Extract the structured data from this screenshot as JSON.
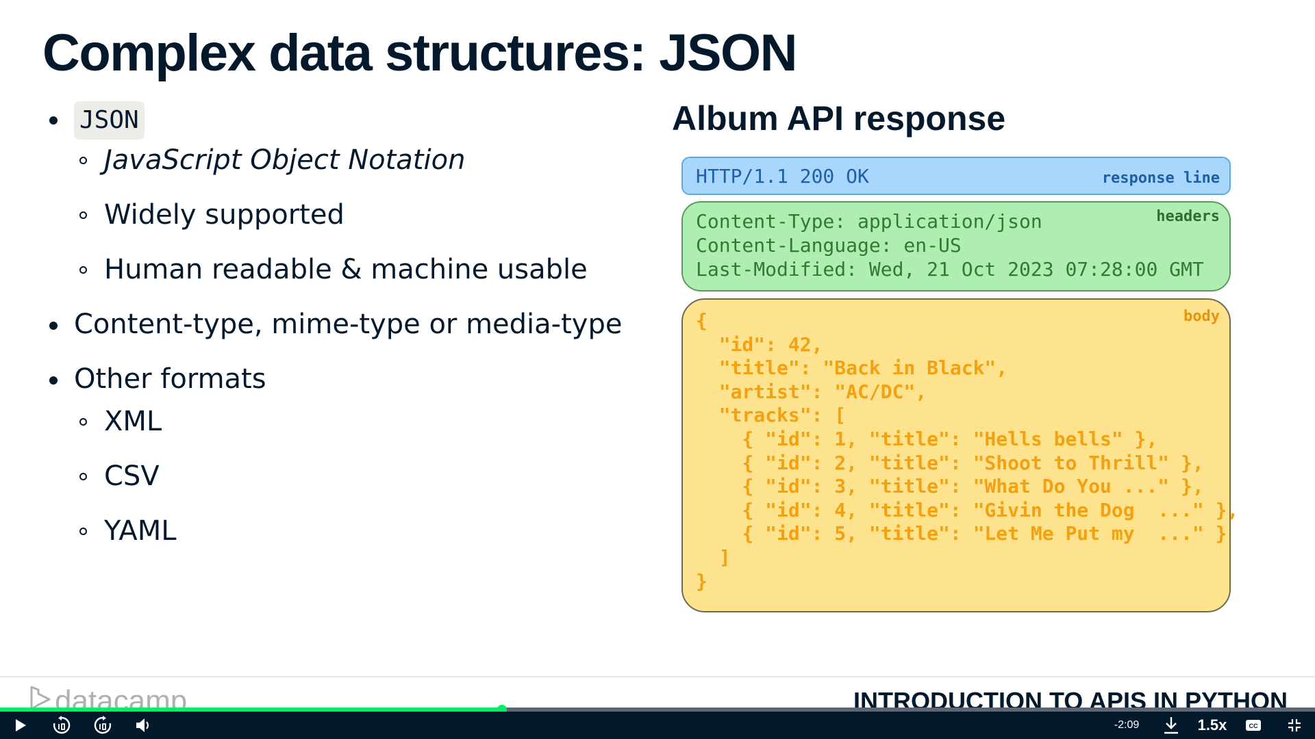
{
  "slide": {
    "title": "Complex data structures: JSON",
    "bullets": {
      "json_code": "JSON",
      "json_full": "JavaScript Object Notation",
      "widely": "Widely supported",
      "human": "Human readable & machine usable",
      "content_type": "Content-type, mime-type or media-type",
      "other": "Other formats",
      "xml": "XML",
      "csv": "CSV",
      "yaml": "YAML"
    },
    "right_title": "Album API response",
    "response_line": {
      "text": "HTTP/1.1 200 OK",
      "tag": "response line"
    },
    "headers": {
      "tag": "headers",
      "lines": [
        "Content-Type: application/json",
        "Content-Language: en-US",
        "Last-Modified: Wed, 21 Oct 2023 07:28:00 GMT"
      ]
    },
    "body": {
      "tag": "body",
      "code": "{\n  \"id\": 42,\n  \"title\": \"Back in Black\",\n  \"artist\": \"AC/DC\",\n  \"tracks\": [\n    { \"id\": 1, \"title\": \"Hells bells\" },\n    { \"id\": 2, \"title\": \"Shoot to Thrill\" },\n    { \"id\": 3, \"title\": \"What Do You ...\" },\n    { \"id\": 4, \"title\": \"Givin the Dog  ...\" },\n    { \"id\": 5, \"title\": \"Let Me Put my  ...\" }\n  ]\n}"
    }
  },
  "footer": {
    "brand": "datacamp",
    "course": "INTRODUCTION TO APIS IN PYTHON"
  },
  "player": {
    "progress_fraction": 0.382,
    "time_remaining": "-2:09",
    "speed": "1.5x",
    "icons": [
      "play-icon",
      "rewind-10-icon",
      "forward-10-icon",
      "volume-icon",
      "download-icon",
      "captions-icon",
      "exit-fullscreen-icon"
    ],
    "colors": {
      "accent": "#03ef62",
      "bar": "#05192d",
      "track": "#5e6673"
    }
  }
}
